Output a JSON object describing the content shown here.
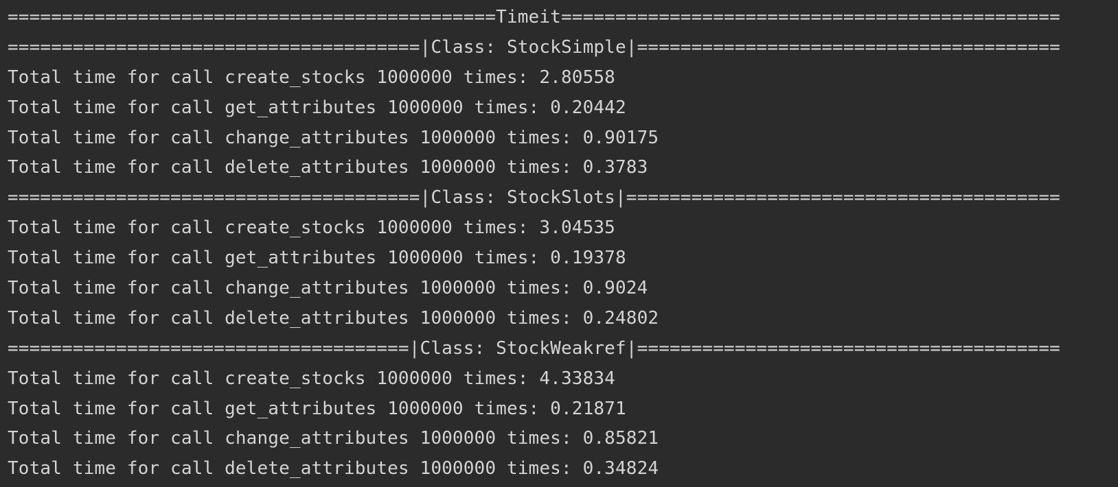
{
  "console": {
    "lines": [
      "=============================================Timeit==============================================",
      "======================================|Class: StockSimple|=======================================",
      "Total time for call create_stocks 1000000 times: 2.80558",
      "Total time for call get_attributes 1000000 times: 0.20442",
      "Total time for call change_attributes 1000000 times: 0.90175",
      "Total time for call delete_attributes 1000000 times: 0.3783",
      "======================================|Class: StockSlots|========================================",
      "Total time for call create_stocks 1000000 times: 3.04535",
      "Total time for call get_attributes 1000000 times: 0.19378",
      "Total time for call change_attributes 1000000 times: 0.9024",
      "Total time for call delete_attributes 1000000 times: 0.24802",
      "=====================================|Class: StockWeakref|=======================================",
      "Total time for call create_stocks 1000000 times: 4.33834",
      "Total time for call get_attributes 1000000 times: 0.21871",
      "Total time for call change_attributes 1000000 times: 0.85821",
      "Total time for call delete_attributes 1000000 times: 0.34824"
    ]
  },
  "colors": {
    "background": "#2b2b2b",
    "text": "#d4d4d4"
  }
}
